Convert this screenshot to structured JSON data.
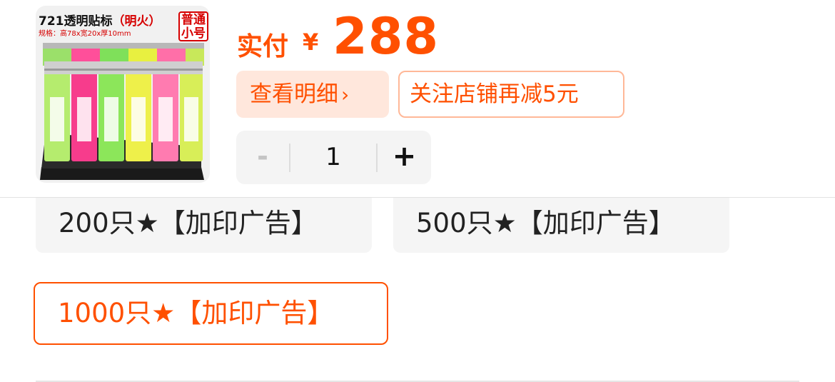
{
  "product": {
    "image_title": "721透明贴标",
    "image_title_note": "（明火）",
    "image_spec": "规格：高78x宽20x厚10mm",
    "image_badge": "普通小号"
  },
  "price": {
    "label": "实付",
    "currency": "¥",
    "value": "288"
  },
  "actions": {
    "detail_label": "查看明细",
    "detail_chevron": "›",
    "follow_label": "关注店铺再减5元"
  },
  "stepper": {
    "minus": "-",
    "quantity": "1",
    "plus": "+"
  },
  "options": [
    {
      "label": "200只★【加印广告】",
      "selected": false
    },
    {
      "label": "500只★【加印广告】",
      "selected": false
    },
    {
      "label": "1000只★【加印广告】",
      "selected": true
    }
  ],
  "colors": {
    "accent": "#ff5000",
    "accent_light": "#ffe7dc",
    "option_bg": "#f5f5f5"
  }
}
